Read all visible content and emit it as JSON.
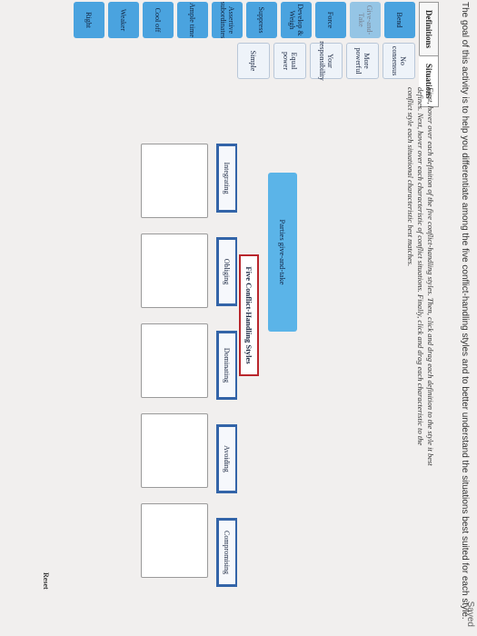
{
  "status": "Saved",
  "intro": "The goal of this activity is to help you differentiate among the five conflict-handling styles and to better understand the situations best suited for each style.",
  "tabs": [
    "Definitions",
    "Situations"
  ],
  "left_column": [
    "Bend",
    "Give-and-Take",
    "Force",
    "Develop & Weigh",
    "Suppress",
    "Assertive subordinates",
    "Ample time",
    "Cool off",
    "Weaker",
    "Right"
  ],
  "situations_column": [
    "No consensus",
    "More powerful",
    "Your responsibility",
    "Equal power",
    "Simple"
  ],
  "instructions": "First, hover over each definition of the five conflict-handling styles. Then, click and drag each definition to the style it best defines. Next, hover over each characteristic of conflict situations. Finally, click and drag each characteristic to the conflict style each situational characteristic best matches.",
  "dragging_item": "Parties give-and-take",
  "section_title": "Five Conflict-Handling Styles",
  "styles": [
    "Integrating",
    "Obliging",
    "Dominating",
    "Avoiding",
    "Compromising"
  ],
  "reset_label": "Reset"
}
